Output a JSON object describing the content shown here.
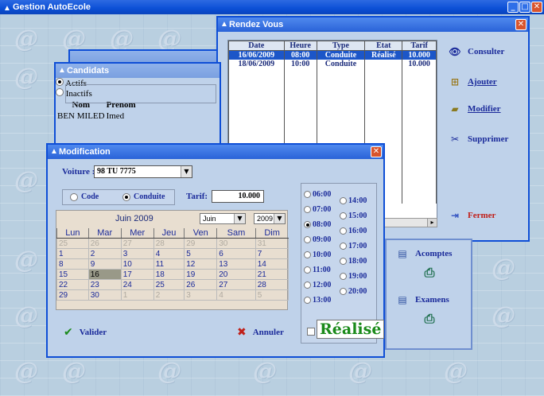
{
  "app": {
    "title": "Gestion AutoEcole",
    "title_icon": "triangle-icon",
    "min": "_",
    "max": "□",
    "close": "✕"
  },
  "background": {
    "logo_text": "@"
  },
  "rendez_vous": {
    "title": "Rendez Vous",
    "columns": [
      "Date",
      "Heure",
      "Type",
      "Etat",
      "Tarif"
    ],
    "rows": [
      {
        "date": "16/06/2009",
        "heure": "08:00",
        "type": "Conduite",
        "etat": "Réalisé",
        "tarif": "10.000"
      },
      {
        "date": "18/06/2009",
        "heure": "10:00",
        "type": "Conduite",
        "etat": "",
        "tarif": "10.000"
      }
    ],
    "actions": {
      "consulter": "Consulter",
      "ajouter": "Ajouter",
      "modifier": "Modifier",
      "supprimer": "Supprimer",
      "fermer": "Fermer"
    },
    "scroll_arrow": "▸"
  },
  "candidats": {
    "title": "Candidats",
    "radio_actifs": "Actifs",
    "radio_inactifs": "Inactifs",
    "columns": [
      "Nom",
      "Prenom"
    ],
    "row": {
      "nom": "BEN MILED",
      "prenom": "Imed"
    }
  },
  "right_panel": {
    "acomptes": "Acomptes",
    "examens": "Examens"
  },
  "modification": {
    "title": "Modification",
    "voiture_label": "Voiture :",
    "voiture_value": "98 TU 7775",
    "code_label": "Code",
    "conduite_label": "Conduite",
    "tarif_label": "Tarif:",
    "tarif_value": "10.000",
    "calendar": {
      "month_title": "Juin 2009",
      "month_select": "Juin",
      "year_select": "2009",
      "days": [
        "Lun",
        "Mar",
        "Mer",
        "Jeu",
        "Ven",
        "Sam",
        "Dim"
      ],
      "weeks": [
        [
          "25",
          "26",
          "27",
          "28",
          "29",
          "30",
          "31"
        ],
        [
          "1",
          "2",
          "3",
          "4",
          "5",
          "6",
          "7"
        ],
        [
          "8",
          "9",
          "10",
          "11",
          "12",
          "13",
          "14"
        ],
        [
          "15",
          "16",
          "17",
          "18",
          "19",
          "20",
          "21"
        ],
        [
          "22",
          "23",
          "24",
          "25",
          "26",
          "27",
          "28"
        ],
        [
          "29",
          "30",
          "1",
          "2",
          "3",
          "4",
          "5"
        ]
      ]
    },
    "hours_left": [
      "06:00",
      "07:00",
      "08:00",
      "09:00",
      "10:00",
      "11:00",
      "12:00",
      "13:00"
    ],
    "hours_right": [
      "14:00",
      "15:00",
      "16:00",
      "17:00",
      "18:00",
      "19:00",
      "20:00"
    ],
    "selected_hour": "08:00",
    "valider": "Valider",
    "annuler": "Annuler",
    "realise": "Réalisé"
  }
}
